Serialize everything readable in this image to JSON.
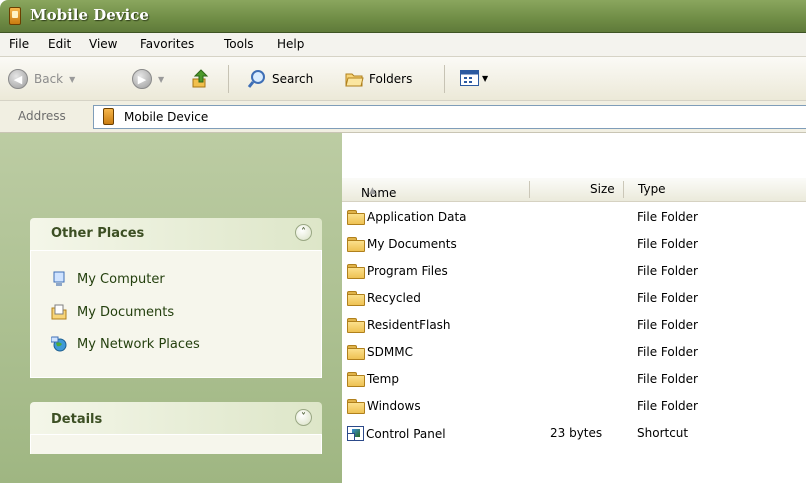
{
  "window": {
    "title": "Mobile Device"
  },
  "menu": [
    "File",
    "Edit",
    "View",
    "Favorites",
    "Tools",
    "Help"
  ],
  "toolbar": {
    "back": "Back",
    "search": "Search",
    "folders": "Folders"
  },
  "address": {
    "label": "Address",
    "value": "Mobile Device"
  },
  "other_places": {
    "title": "Other Places",
    "items": [
      "My Computer",
      "My Documents",
      "My Network Places"
    ]
  },
  "details": {
    "title": "Details"
  },
  "columns": {
    "name": "Name",
    "size": "Size",
    "type": "Type"
  },
  "files": [
    {
      "name": "Application Data",
      "size": "",
      "type": "File Folder",
      "icon": "folder-icon"
    },
    {
      "name": "My Documents",
      "size": "",
      "type": "File Folder",
      "icon": "folder-icon"
    },
    {
      "name": "Program Files",
      "size": "",
      "type": "File Folder",
      "icon": "folder-icon"
    },
    {
      "name": "Recycled",
      "size": "",
      "type": "File Folder",
      "icon": "folder-icon"
    },
    {
      "name": "ResidentFlash",
      "size": "",
      "type": "File Folder",
      "icon": "folder-icon"
    },
    {
      "name": "SDMMC",
      "size": "",
      "type": "File Folder",
      "icon": "folder-icon"
    },
    {
      "name": "Temp",
      "size": "",
      "type": "File Folder",
      "icon": "folder-icon"
    },
    {
      "name": "Windows",
      "size": "",
      "type": "File Folder",
      "icon": "folder-icon"
    },
    {
      "name": "Control Panel",
      "size": "23 bytes",
      "type": "Shortcut",
      "icon": "shortcut-icon"
    }
  ],
  "colors": {
    "titlebar": "#6f8c45",
    "taskpane": "#a4b989",
    "panel_text": "#3c4f23"
  }
}
